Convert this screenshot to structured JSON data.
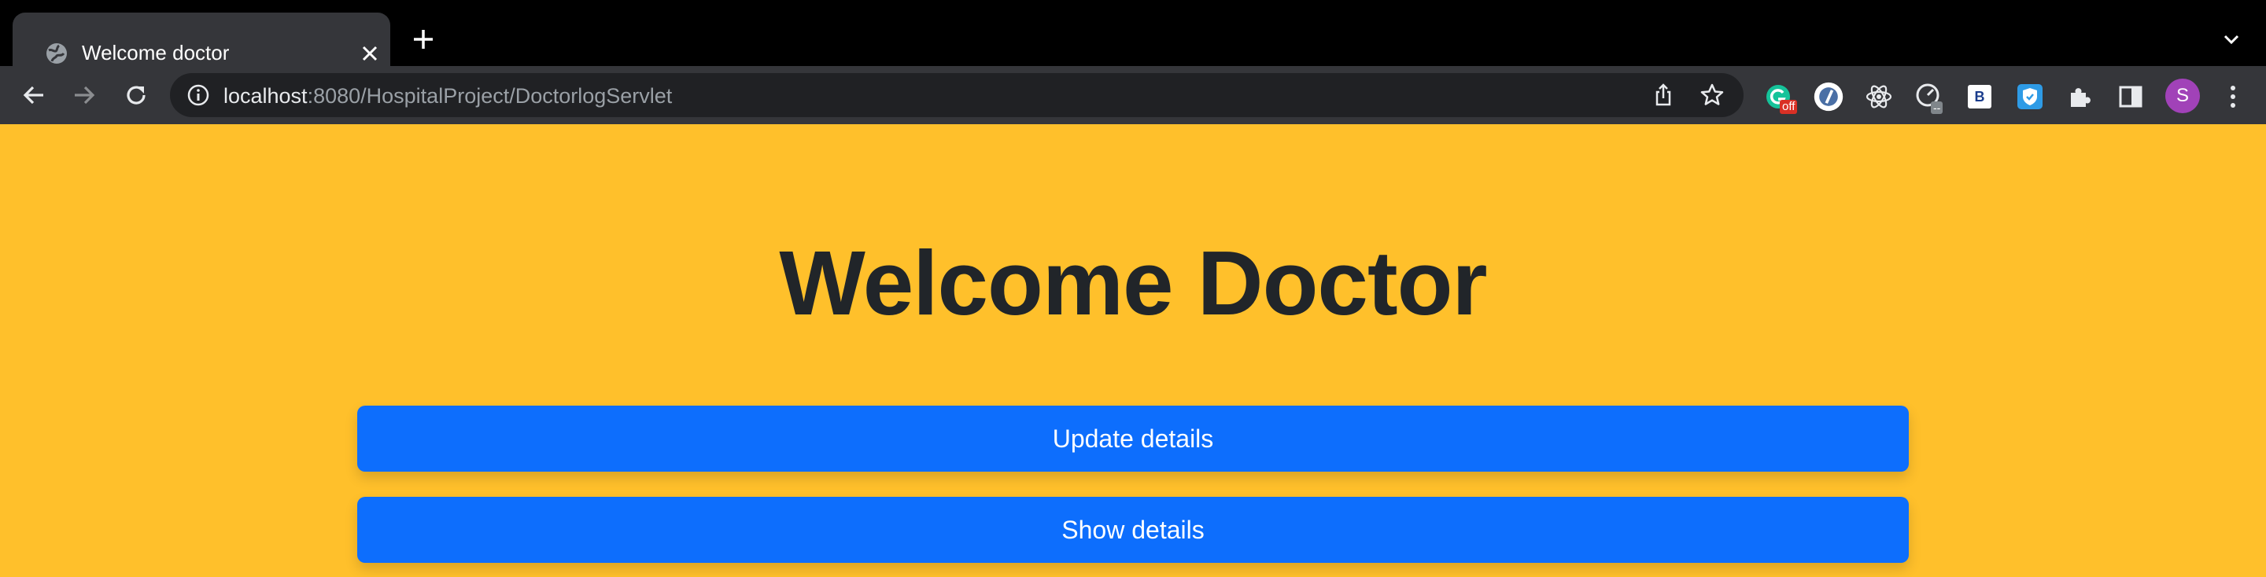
{
  "browser": {
    "tab": {
      "title": "Welcome doctor"
    },
    "address": {
      "host": "localhost",
      "path": ":8080/HospitalProject/DoctorlogServlet"
    },
    "extensions": {
      "grammarly_badge": "off",
      "devtools_badge": "--",
      "b_label": "B",
      "profile_initial": "S"
    }
  },
  "page": {
    "heading": "Welcome Doctor",
    "buttons": {
      "update": "Update details",
      "show": "Show details"
    },
    "colors": {
      "background": "#ffc02b",
      "button": "#0d6efd",
      "heading": "#212529"
    }
  }
}
